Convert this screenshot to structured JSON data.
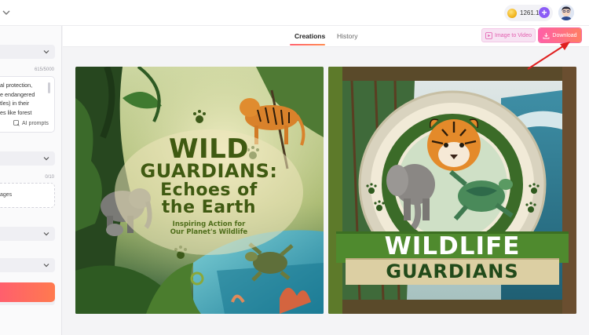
{
  "topbar": {
    "credits": "1261.1",
    "plus_label": "+"
  },
  "left_panel": {
    "char_count": "615/5000",
    "prompt_text": "al protection,\ne endangered\ntles) in their\nes like forest",
    "ai_prompts_label": "AI prompts",
    "image_count": "0/10",
    "upload_label": "ages"
  },
  "main": {
    "tabs": [
      {
        "label": "Creations",
        "active": true
      },
      {
        "label": "History",
        "active": false
      }
    ],
    "image_to_video_label": "Image to Video",
    "download_label": "Download"
  },
  "poster1": {
    "title_line1": "WILD",
    "title_line2": "GUARDIANS:",
    "title_line3": "Echoes of",
    "title_line4": "the Earth",
    "subtitle_line1": "Inspiring Action for",
    "subtitle_line2": "Our Planet's Wildlife"
  },
  "poster2": {
    "title_line1": "WILDLIFE",
    "title_line2": "GUARDIANS"
  },
  "colors": {
    "accent_pink": "#ff5fa8",
    "accent_orange": "#ff7e63",
    "arrow_red": "#e02020",
    "purple": "#8b5cf6"
  },
  "icons": [
    "chevron-down-icon",
    "coin-icon",
    "plus-icon",
    "avatar-icon",
    "ai-prompts-icon",
    "image-to-video-icon",
    "download-icon",
    "annotation-arrow-icon"
  ]
}
